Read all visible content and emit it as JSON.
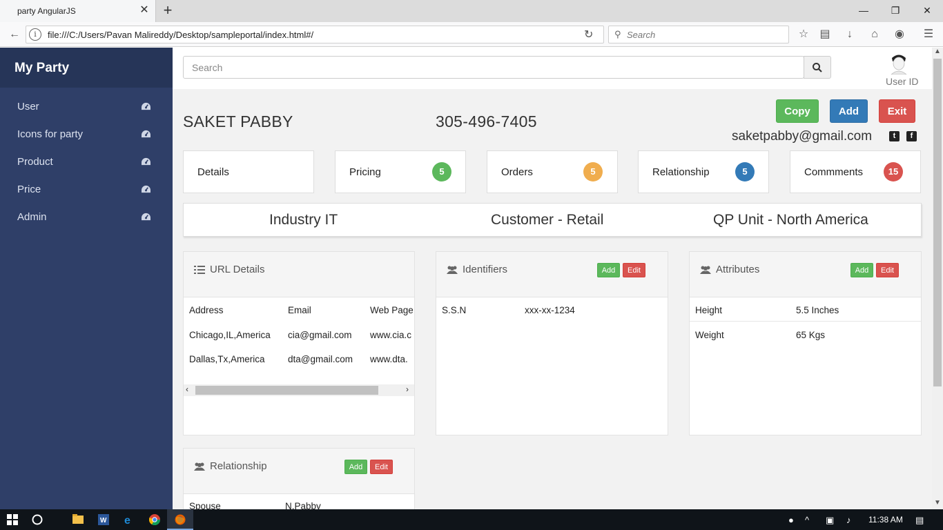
{
  "browser": {
    "tab_title": "party AngularJS",
    "url": "file:///C:/Users/Pavan Malireddy/Desktop/sampleportal/index.html#/",
    "search_placeholder": "Search"
  },
  "sidebar": {
    "brand": "My Party",
    "items": [
      {
        "label": "User",
        "icon": "dashboard-icon"
      },
      {
        "label": "Icons for party",
        "icon": "dashboard-icon"
      },
      {
        "label": "Product",
        "icon": "dashboard-icon"
      },
      {
        "label": "Price",
        "icon": "dashboard-icon"
      },
      {
        "label": "Admin",
        "icon": "dashboard-icon"
      }
    ]
  },
  "topbar": {
    "search_placeholder": "Search",
    "user_label": "User ID"
  },
  "person": {
    "name": "SAKET PABBY",
    "phone": "305-496-7405",
    "email": "saketpabby@gmail.com"
  },
  "actions": {
    "copy": "Copy",
    "add": "Add",
    "exit": "Exit"
  },
  "stats": [
    {
      "label": "Details",
      "count": null,
      "color": null
    },
    {
      "label": "Pricing",
      "count": "5",
      "color": "#5cb85c"
    },
    {
      "label": "Orders",
      "count": "5",
      "color": "#f0ad4e"
    },
    {
      "label": "Relationship",
      "count": "5",
      "color": "#337ab7"
    },
    {
      "label": "Commments",
      "count": "15",
      "color": "#d9534f"
    }
  ],
  "info_strip": {
    "industry": "Industry IT",
    "customer": "Customer - Retail",
    "unit": "QP Unit - North America"
  },
  "url_details": {
    "title": "URL Details",
    "headers": [
      "Address",
      "Email",
      "Web Page"
    ],
    "rows": [
      [
        "Chicago,IL,America",
        "cia@gmail.com",
        "www.cia.c"
      ],
      [
        "Dallas,Tx,America",
        "dta@gmail.com",
        "www.dta."
      ]
    ]
  },
  "identifiers": {
    "title": "Identifiers",
    "add": "Add",
    "edit": "Edit",
    "rows": [
      [
        "S.S.N",
        "xxx-xx-1234"
      ]
    ]
  },
  "attributes": {
    "title": "Attributes",
    "add": "Add",
    "edit": "Edit",
    "rows": [
      [
        "Height",
        "5.5 Inches"
      ],
      [
        "Weight",
        "65 Kgs"
      ]
    ]
  },
  "relationship": {
    "title": "Relationship",
    "add": "Add",
    "edit": "Edit",
    "rows": [
      [
        "Spouse",
        "N.Pabby"
      ]
    ]
  },
  "taskbar": {
    "time": "11:38 AM"
  },
  "colors": {
    "sidebar": "#2f3f68",
    "sidebar_brand": "#263558",
    "green": "#5cb85c",
    "blue": "#337ab7",
    "red": "#d9534f",
    "orange": "#f0ad4e"
  }
}
